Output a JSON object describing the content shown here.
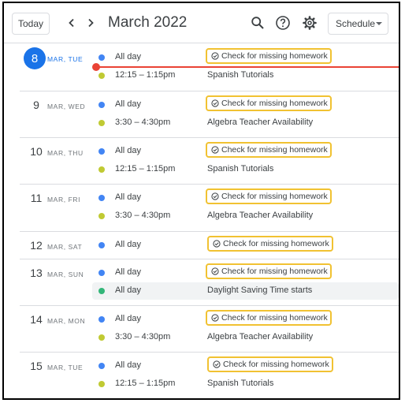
{
  "header": {
    "today_label": "Today",
    "prev_icon": "chevron-left-icon",
    "next_icon": "chevron-right-icon",
    "title": "March 2022",
    "search_icon": "search-icon",
    "help_icon": "help-icon",
    "settings_icon": "gear-icon",
    "view_label": "Schedule"
  },
  "colors": {
    "task_blue": "#4285f4",
    "green_yellow": "#c0ca33",
    "dark_green": "#33b679",
    "today_blue": "#1a73e8",
    "now_red": "#ea4335",
    "highlight_border": "#f1c232"
  },
  "days": [
    {
      "num": "8",
      "label": "MAR, TUE",
      "today": true,
      "events": [
        {
          "time": "All day",
          "title": "Check for missing homework",
          "task": true,
          "color": "#4285f4"
        },
        {
          "time": "12:15 – 1:15pm",
          "title": "Spanish Tutorials",
          "task": false,
          "color": "#c0ca33"
        }
      ]
    },
    {
      "num": "9",
      "label": "MAR, WED",
      "events": [
        {
          "time": "All day",
          "title": "Check for missing homework",
          "task": true,
          "color": "#4285f4"
        },
        {
          "time": "3:30 – 4:30pm",
          "title": "Algebra Teacher Availability",
          "task": false,
          "color": "#c0ca33"
        }
      ]
    },
    {
      "num": "10",
      "label": "MAR, THU",
      "events": [
        {
          "time": "All day",
          "title": "Check for missing homework",
          "task": true,
          "color": "#4285f4"
        },
        {
          "time": "12:15 – 1:15pm",
          "title": "Spanish Tutorials",
          "task": false,
          "color": "#c0ca33"
        }
      ]
    },
    {
      "num": "11",
      "label": "MAR, FRI",
      "events": [
        {
          "time": "All day",
          "title": "Check for missing homework",
          "task": true,
          "color": "#4285f4"
        },
        {
          "time": "3:30 – 4:30pm",
          "title": "Algebra Teacher Availability",
          "task": false,
          "color": "#c0ca33"
        }
      ]
    },
    {
      "num": "12",
      "label": "MAR, SAT",
      "events": [
        {
          "time": "All day",
          "title": "Check for missing homework",
          "task": true,
          "color": "#4285f4"
        }
      ]
    },
    {
      "num": "13",
      "label": "MAR, SUN",
      "events": [
        {
          "time": "All day",
          "title": "Check for missing homework",
          "task": true,
          "color": "#4285f4"
        },
        {
          "time": "All day",
          "title": "Daylight Saving Time starts",
          "task": false,
          "color": "#33b679",
          "highlighted": true
        }
      ]
    },
    {
      "num": "14",
      "label": "MAR, MON",
      "events": [
        {
          "time": "All day",
          "title": "Check for missing homework",
          "task": true,
          "color": "#4285f4"
        },
        {
          "time": "3:30 – 4:30pm",
          "title": "Algebra Teacher Availability",
          "task": false,
          "color": "#c0ca33"
        }
      ]
    },
    {
      "num": "15",
      "label": "MAR, TUE",
      "events": [
        {
          "time": "All day",
          "title": "Check for missing homework",
          "task": true,
          "color": "#4285f4"
        },
        {
          "time": "12:15 – 1:15pm",
          "title": "Spanish Tutorials",
          "task": false,
          "color": "#c0ca33"
        }
      ]
    }
  ]
}
